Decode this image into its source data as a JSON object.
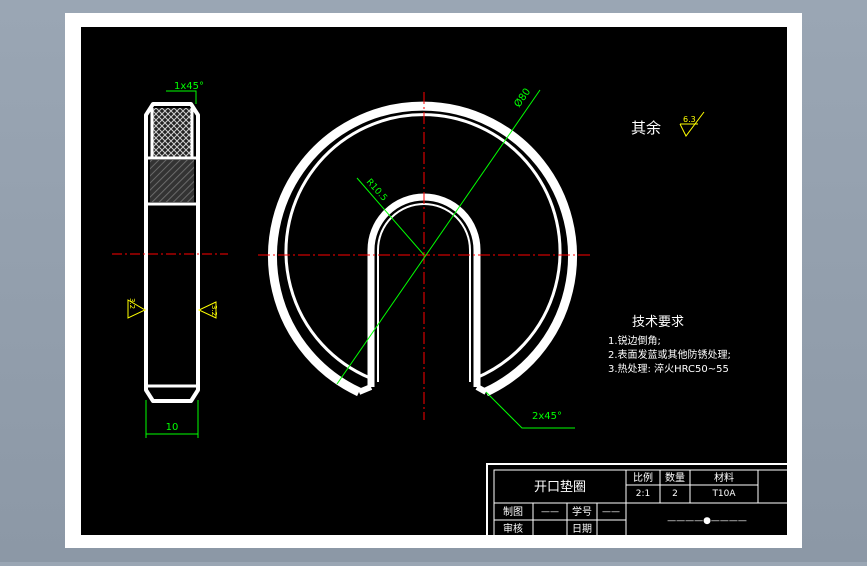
{
  "drawing": {
    "surface_finish_label": "其余",
    "surface_finish_value": "6.3",
    "chamfer_top": "1x45°",
    "chamfer_bottom": "2x45°",
    "dim_width": "10",
    "dim_diameter": "Ø80",
    "dim_radius": "R10.5",
    "roughness_left": "3.2",
    "roughness_right": "3.2"
  },
  "tech_requirements": {
    "title": "技术要求",
    "items": [
      "1.锐边倒角;",
      "2.表面发蓝或其他防锈处理;",
      "3.热处理: 淬火HRC50~55"
    ]
  },
  "title_block": {
    "part_name": "开口垫圈",
    "header_scale": "比例",
    "header_qty": "数量",
    "header_material": "材料",
    "scale": "2:1",
    "qty": "2",
    "material": "T10A",
    "drawn_label": "制图",
    "drawn_value": "——",
    "checked_label": "审核",
    "student_id_label": "学号",
    "student_id_value": "——",
    "date_label": "日期",
    "code": "————●————"
  },
  "colors": {
    "frame": "#ffffff",
    "background": "#000000",
    "centerline": "#ff0000",
    "dimension": "#00ff00",
    "hatch_dark": "#555555"
  }
}
